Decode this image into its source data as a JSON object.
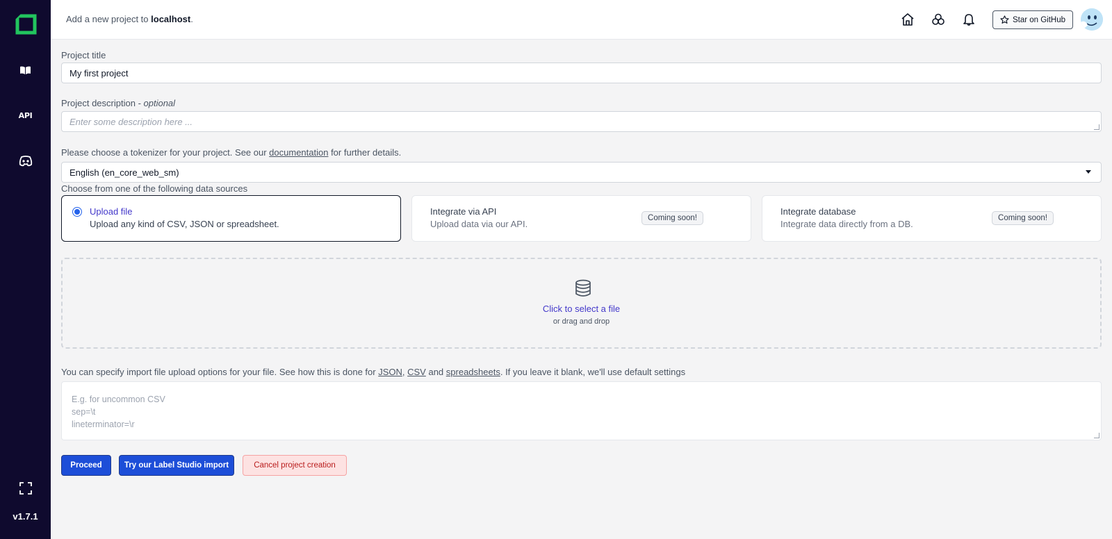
{
  "sidebar": {
    "version": "v1.7.1",
    "api_label": "API",
    "icons": [
      "logo-icon",
      "book-icon",
      "api-icon",
      "discord-icon",
      "fullscreen-icon"
    ]
  },
  "header": {
    "prefix": "Add a new project to ",
    "host": "localhost",
    "suffix": ".",
    "star_label": "Star on GitHub",
    "icons": [
      "home-icon",
      "help-icon",
      "bell-icon",
      "star-icon"
    ]
  },
  "form": {
    "title_label": "Project title",
    "title_value": "My first project",
    "desc_label": "Project description",
    "desc_optional_sep": " - ",
    "desc_optional": "optional",
    "desc_placeholder": "Enter some description here ...",
    "tokenizer_prefix": "Please choose a tokenizer for your project. See our ",
    "tokenizer_link": "documentation",
    "tokenizer_suffix": " for further details.",
    "tokenizer_value": "English (en_core_web_sm)",
    "sources_label": "Choose from one of the following data sources"
  },
  "sources": [
    {
      "title": "Upload file",
      "desc": "Upload any kind of CSV, JSON or spreadsheet.",
      "selected": true,
      "badge": ""
    },
    {
      "title": "Integrate via API",
      "desc": "Upload data via our API.",
      "selected": false,
      "badge": "Coming soon!"
    },
    {
      "title": "Integrate database",
      "desc": "Integrate data directly from a DB.",
      "selected": false,
      "badge": "Coming soon!"
    }
  ],
  "dropzone": {
    "title": "Click to select a file",
    "subtitle": "or drag and drop"
  },
  "import_options": {
    "prefix": "You can specify import file upload options for your file. See how this is done for ",
    "link_json": "JSON",
    "sep1": ", ",
    "link_csv": "CSV",
    "sep2": " and ",
    "link_sheets": "spreadsheets",
    "suffix": ". If you leave it blank, we'll use default settings",
    "placeholder_line1": "E.g. for uncommon CSV",
    "placeholder_line2": "sep=\\t",
    "placeholder_line3": "lineterminator=\\r"
  },
  "buttons": {
    "proceed": "Proceed",
    "label_studio": "Try our Label Studio import",
    "cancel": "Cancel project creation"
  },
  "colors": {
    "sidebar_bg": "#0f0a2e",
    "logo_green": "#22c55e",
    "primary": "#1d4ed8",
    "link": "#4338ca",
    "cancel_bg": "#fde2e2"
  }
}
